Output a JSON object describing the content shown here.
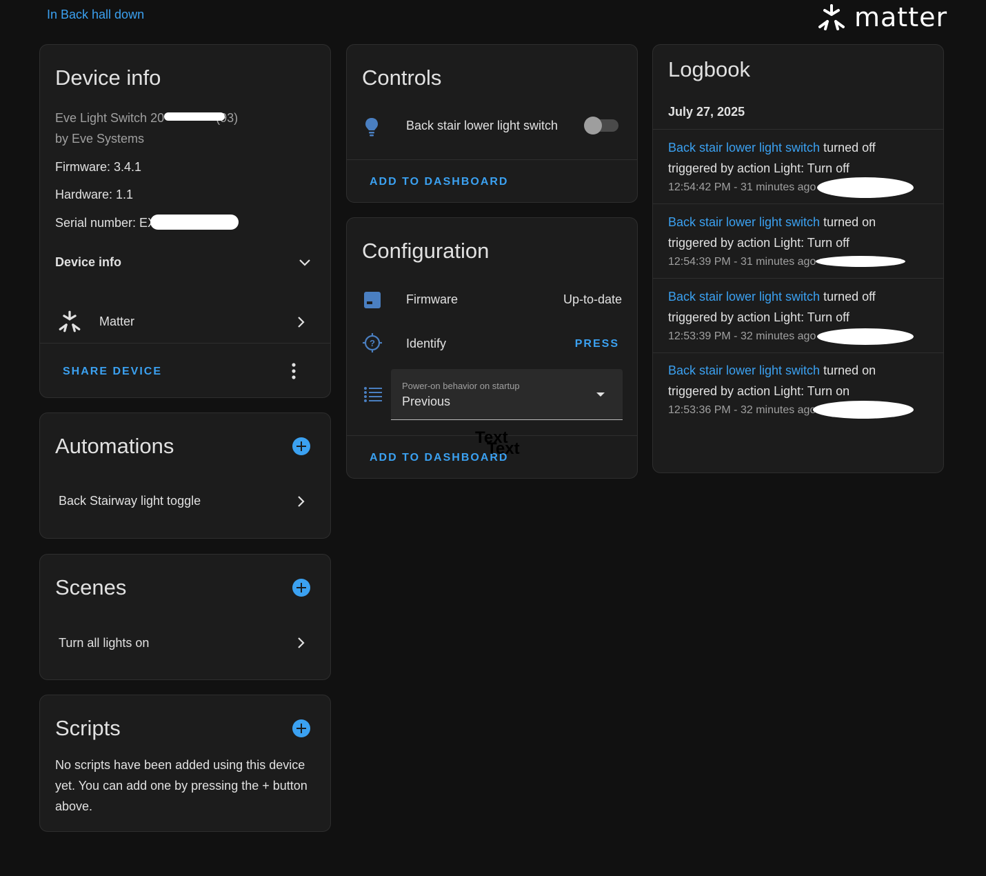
{
  "header": {
    "area_link": "In Back hall down",
    "brand": "matter"
  },
  "device_info": {
    "title": "Device info",
    "model": "Eve Light Switch 20               (93)",
    "manufacturer": "by Eve Systems",
    "firmware": "Firmware: 3.4.1",
    "hardware": "Hardware: 1.1",
    "serial": "Serial number: EX",
    "expander_label": "Device info",
    "integration": "Matter",
    "share_label": "SHARE DEVICE"
  },
  "automations": {
    "title": "Automations",
    "items": [
      "Back Stairway light toggle"
    ]
  },
  "scenes": {
    "title": "Scenes",
    "items": [
      "Turn all lights on"
    ]
  },
  "scripts": {
    "title": "Scripts",
    "empty_text": "No scripts have been added using this device yet. You can add one by pressing the + button above."
  },
  "controls": {
    "title": "Controls",
    "entity": "Back stair lower light switch",
    "state": "off",
    "add_label": "ADD TO DASHBOARD"
  },
  "configuration": {
    "title": "Configuration",
    "firmware_label": "Firmware",
    "firmware_value": "Up-to-date",
    "identify_label": "Identify",
    "identify_action": "PRESS",
    "select_label": "Power-on behavior on startup",
    "select_value": "Previous",
    "overlay_1": "Text",
    "overlay_2": "Text",
    "add_label": "ADD TO DASHBOARD"
  },
  "logbook": {
    "title": "Logbook",
    "date": "July 27, 2025",
    "entries": [
      {
        "entity": "Back stair lower light switch",
        "action": " turned off",
        "trigger": "triggered by action Light: Turn off",
        "time": "12:54:42 PM - 31 minutes ago"
      },
      {
        "entity": "Back stair lower light switch",
        "action": " turned on",
        "trigger": "triggered by action Light: Turn off",
        "time": "12:54:39 PM - 31 minutes ago"
      },
      {
        "entity": "Back stair lower light switch",
        "action": " turned off",
        "trigger": "triggered by action Light: Turn off",
        "time": "12:53:39 PM - 32 minutes ago"
      },
      {
        "entity": "Back stair lower light switch",
        "action": " turned on",
        "trigger": "triggered by action Light: Turn on",
        "time": "12:53:36 PM - 32 minutes ago"
      }
    ]
  },
  "colors": {
    "background": "#111111",
    "card": "#1c1c1c",
    "accent": "#3ba1f1",
    "text": "#e1e1e1",
    "muted": "#a0a0a0"
  }
}
